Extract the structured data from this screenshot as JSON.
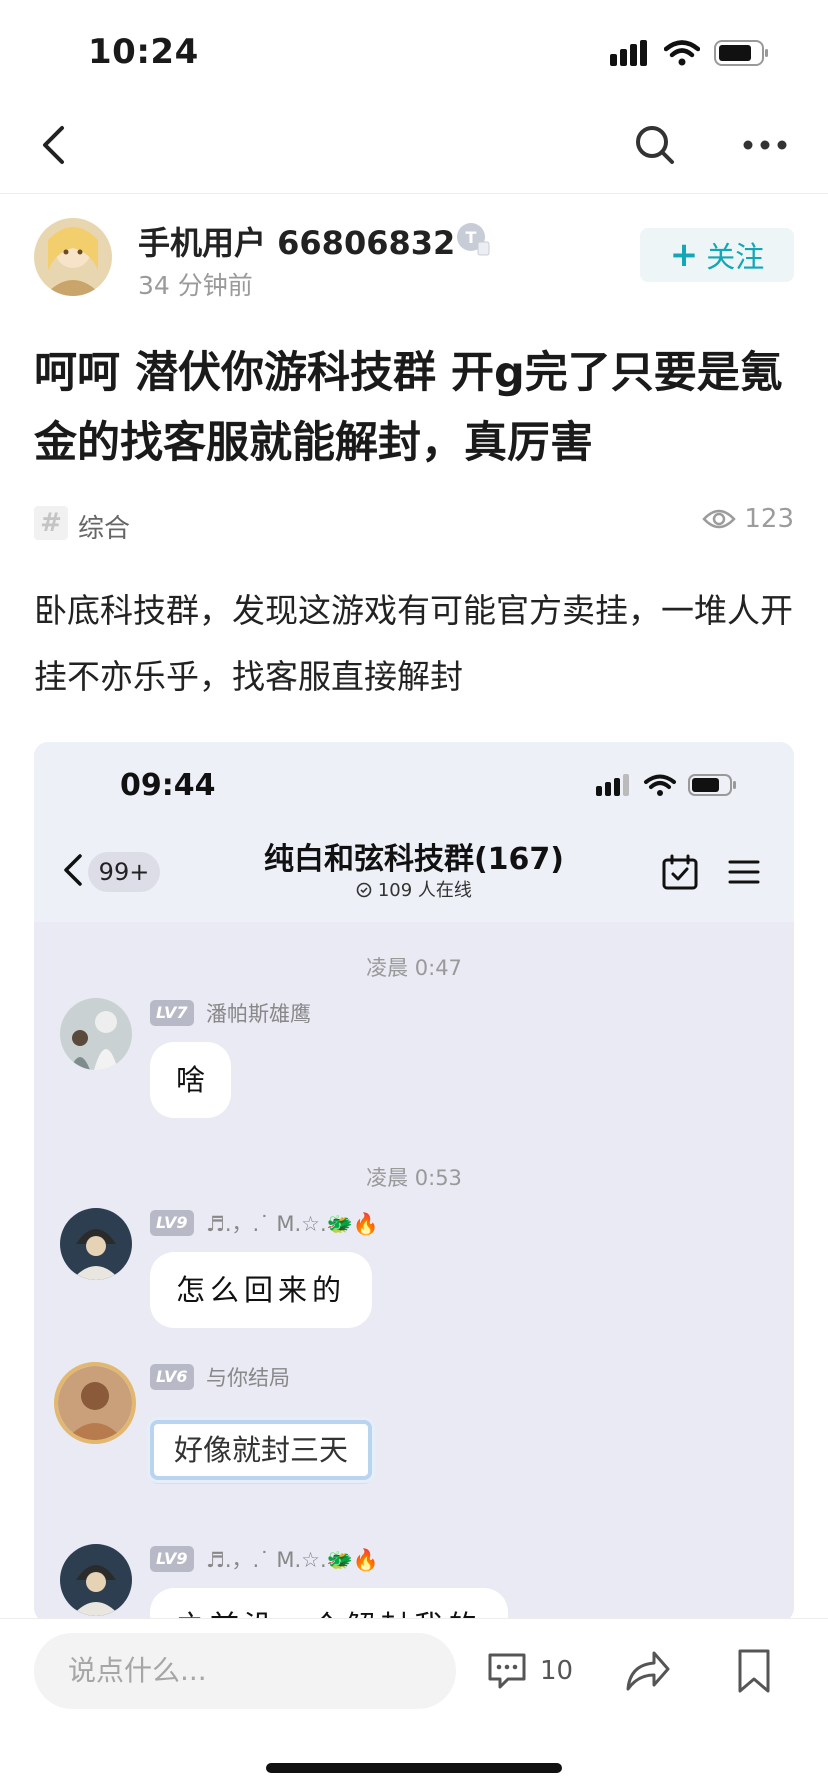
{
  "status_bar": {
    "time": "10:24"
  },
  "nav": {
    "back_icon": "chevron-left-icon",
    "search_icon": "search-icon",
    "more_icon": "more-dots-icon"
  },
  "author": {
    "name": "手机用户 66806832",
    "time_ago": "34 分钟前",
    "follow_label": "关注",
    "follow_plus": "+"
  },
  "post": {
    "title": "呵呵 潜伏你游科技群 开g完了只要是氪金的找客服就能解封，真厉害",
    "tag": "综合",
    "tag_icon": "#",
    "views": "123",
    "body": "卧底科技群，发现这游戏有可能官方卖挂，一堆人开挂不亦乐乎，找客服直接解封"
  },
  "screenshot": {
    "time": "09:44",
    "unread": "99+",
    "group_title": "纯白和弦科技群(167)",
    "online": "109 人在线",
    "messages": [
      {
        "timestamp": "凌晨 0:47",
        "level": "LV7",
        "nick": "潘帕斯雄鹰",
        "text": "啥"
      },
      {
        "timestamp": "凌晨 0:53",
        "level": "LV9",
        "nick": "♬.，.˙ M.☆.🐲🔥",
        "text": "怎么回来的"
      },
      {
        "level": "LV6",
        "nick": "与你结局",
        "text": "好像就封三天"
      },
      {
        "level": "LV9",
        "nick": "♬.，.˙ M.☆.🐲🔥",
        "text": "之前没一个解封我的"
      }
    ]
  },
  "bottom": {
    "input_placeholder": "说点什么...",
    "comment_count": "10",
    "share_icon": "share-icon",
    "bookmark_icon": "bookmark-icon"
  },
  "colors": {
    "accent": "#12a6b7",
    "follow_bg": "#eef5f6",
    "chat_bg": "#e9eaf4"
  }
}
